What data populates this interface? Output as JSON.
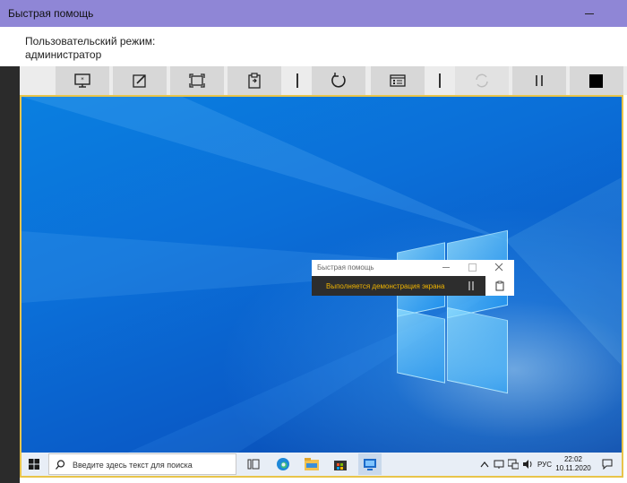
{
  "app": {
    "title": "Быстрая помощь"
  },
  "header": {
    "mode_label": "Пользовательский режим:",
    "mode_value": "администратор"
  },
  "toolbar": {
    "buttons": [
      {
        "icon": "monitor-select-icon"
      },
      {
        "icon": "annotate-pen-icon"
      },
      {
        "icon": "actual-size-icon"
      },
      {
        "icon": "clipboard-icon"
      },
      {
        "icon": "restart-icon"
      },
      {
        "icon": "task-manager-icon"
      },
      {
        "icon": "reconnect-icon"
      },
      {
        "icon": "pause-icon"
      },
      {
        "icon": "end-icon"
      }
    ]
  },
  "remote": {
    "mini_window": {
      "title": "Быстрая помощь",
      "status": "Выполняется демонстрация экрана"
    },
    "taskbar": {
      "search_placeholder": "Введите здесь текст для поиска",
      "language": "РУС",
      "time": "22:02",
      "date": "10.11.2020"
    }
  },
  "colors": {
    "titlebar": "#8f86d6",
    "accent_frame": "#e8c44a",
    "status_text": "#f0b400"
  }
}
